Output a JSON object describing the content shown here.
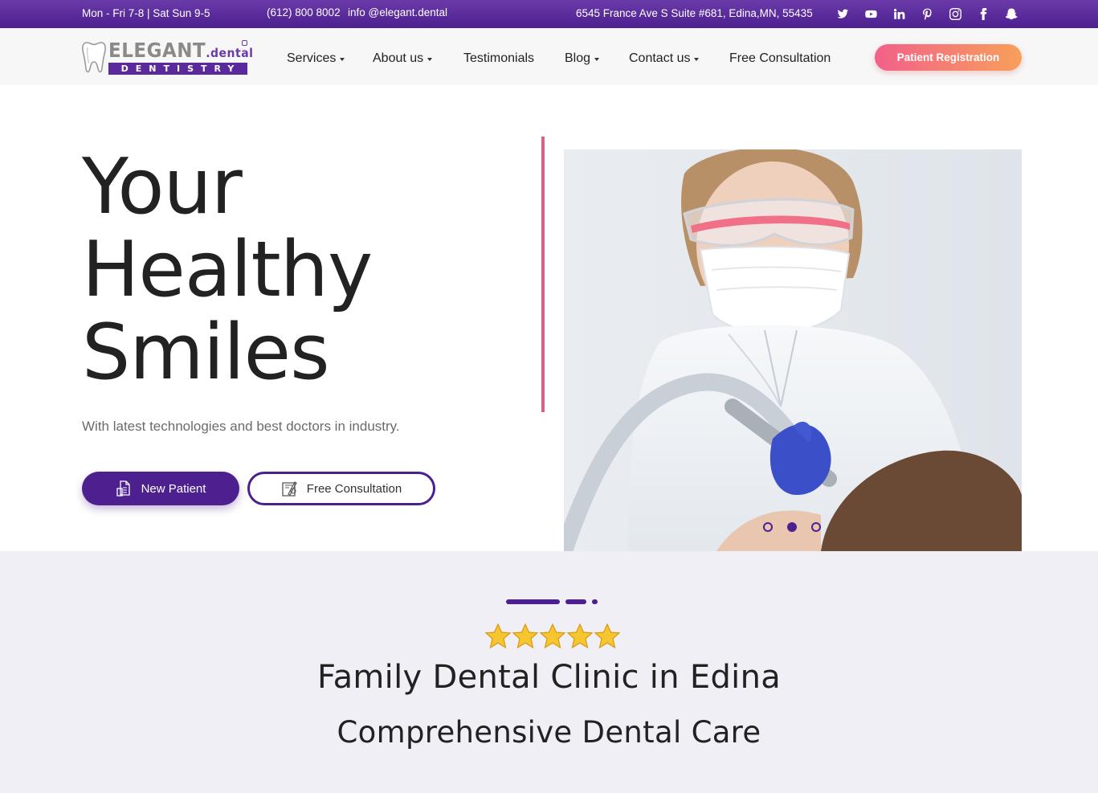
{
  "topbar": {
    "hours": "Mon - Fri 7-8 | Sat Sun 9-5",
    "phone": "(612) 800 8002",
    "email": "info @elegant.dental",
    "address": "6545 France Ave S Suite #681, Edina,MN, 55435",
    "socials": [
      "twitter-icon",
      "youtube-icon",
      "linkedin-icon",
      "pinterest-icon",
      "instagram-icon",
      "facebook-icon",
      "snapchat-icon"
    ]
  },
  "logo": {
    "brand": "ELEGANT",
    "brand_suffix": ".dental",
    "strip": "DENTISTRY"
  },
  "nav": {
    "items": [
      {
        "label": "Services",
        "dropdown": true
      },
      {
        "label": "About us",
        "dropdown": true
      },
      {
        "label": "Testimonials",
        "dropdown": false
      },
      {
        "label": "Blog",
        "dropdown": true
      },
      {
        "label": "Contact us",
        "dropdown": true
      },
      {
        "label": "Free Consultation",
        "dropdown": false
      }
    ],
    "cta": "Patient Registration"
  },
  "hero": {
    "title_lines": [
      "Your",
      "Healthy",
      "Smiles"
    ],
    "subtitle": "With latest technologies and best doctors in industry.",
    "primary_button": "New Patient",
    "secondary_button": "Free Consultation",
    "carousel": {
      "total": 3,
      "active_index": 1
    }
  },
  "section2": {
    "rating": 5,
    "title": "Family Dental Clinic in Edina",
    "subtitle": "Comprehensive Dental Care"
  },
  "colors": {
    "primary": "#4d2090",
    "accent_pink": "#d96088",
    "cta_gradient_start": "#f2608a",
    "cta_gradient_end": "#f7a05a",
    "section_bg": "#f1eff6"
  }
}
